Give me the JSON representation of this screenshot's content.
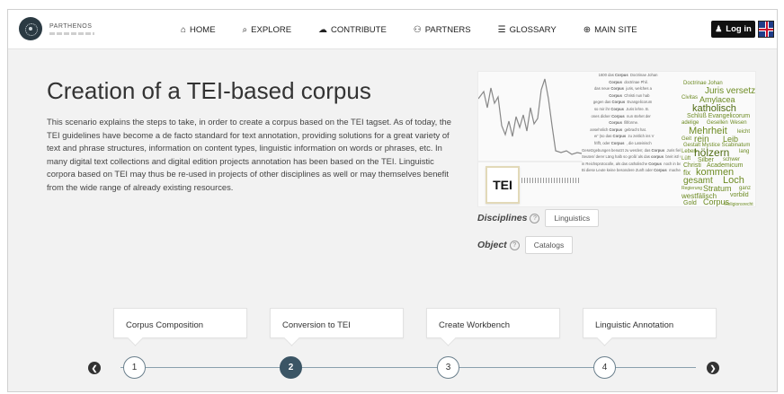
{
  "header": {
    "logo_name": "PARTHENOS",
    "nav": [
      {
        "icon": "home-icon",
        "glyph": "⌂",
        "label": "HOME"
      },
      {
        "icon": "search-icon",
        "glyph": "⌕",
        "label": "EXPLORE"
      },
      {
        "icon": "cloud-upload-icon",
        "glyph": "☁",
        "label": "CONTRIBUTE"
      },
      {
        "icon": "users-icon",
        "glyph": "⚇",
        "label": "PARTNERS"
      },
      {
        "icon": "list-icon",
        "glyph": "☰",
        "label": "GLOSSARY"
      },
      {
        "icon": "globe-icon",
        "glyph": "⊕",
        "label": "MAIN SITE"
      }
    ],
    "login_label": "Log in",
    "language_flag": "uk-flag-icon"
  },
  "main": {
    "title": "Creation of a TEI-based corpus",
    "description": "This scenario explains the steps to take, in order to create a corpus based on the TEI tagset. As of today, the TEI guidelines have become a de facto standard for text annotation, providing solutions for a great variety of text and phrase structures, information on content types, linguistic information on words or phrases, etc. In many digital text collections and digital edition projects annotation has been based on the TEI. Linguistic corpora based on TEI may thus be re-used in projects of other disciplines as well or may themselves benefit from the wide range of already existing resources.",
    "hero_badge": "TEI",
    "disciplines_label": "Disciplines",
    "disciplines_value": "Linguistics",
    "object_label": "Object",
    "object_value": "Catalogs"
  },
  "steps": [
    {
      "label": "Corpus Composition",
      "number": "1",
      "active": false
    },
    {
      "label": "Conversion to TEI",
      "number": "2",
      "active": true
    },
    {
      "label": "Create Workbench",
      "number": "3",
      "active": false
    },
    {
      "label": "Linguistic Annotation",
      "number": "4",
      "active": false
    }
  ],
  "colors": {
    "active_step": "#3b5565",
    "login_bg": "#111111",
    "cloud_green": "#6d8b23"
  }
}
